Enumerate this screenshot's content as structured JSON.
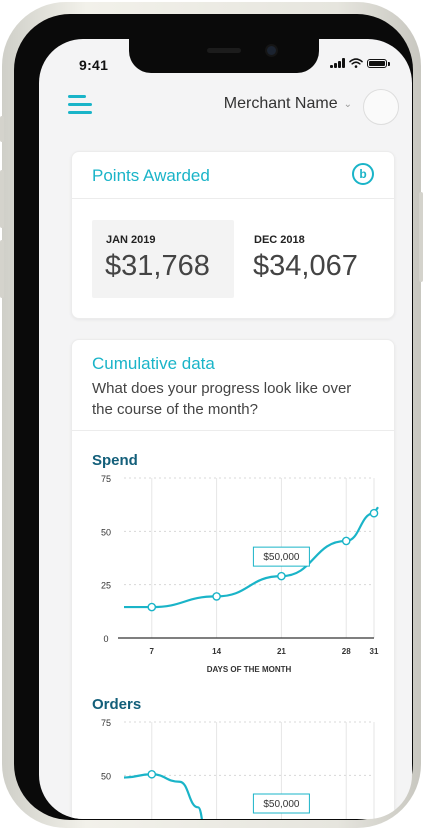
{
  "status_bar": {
    "time": "9:41"
  },
  "header": {
    "merchant_name": "Merchant Name",
    "merchant_chevron": "⌄"
  },
  "points_card": {
    "title": "Points Awarded",
    "badge_letter": "b",
    "periods": [
      {
        "label": "JAN 2019",
        "value": "$31,768"
      },
      {
        "label": "DEC 2018",
        "value": "$34,067"
      }
    ]
  },
  "cumulative_card": {
    "title": "Cumulative data",
    "subtitle": "What does your progress look like over the course of the month?"
  },
  "colors": {
    "accent": "#1ab4c8",
    "heading": "#135f7a"
  },
  "chart_data": [
    {
      "type": "line",
      "title": "Spend",
      "xlabel": "DAYS OF THE MONTH",
      "ylabel": "",
      "x_ticks": [
        "7",
        "14",
        "21",
        "28",
        "31"
      ],
      "y_ticks": [
        "75",
        "50",
        "25",
        "0"
      ],
      "ylim": [
        0,
        75
      ],
      "xlim": [
        4,
        31
      ],
      "grid": true,
      "series": [
        {
          "x": [
            7,
            14,
            21,
            28,
            31
          ],
          "y": [
            14.5,
            19.5,
            29,
            45.5,
            58.5
          ]
        }
      ],
      "annotation": {
        "x": 21,
        "y": 29,
        "label": "$50,000"
      }
    },
    {
      "type": "line",
      "title": "Orders",
      "xlabel": "",
      "ylabel": "",
      "y_ticks": [
        "75",
        "50"
      ],
      "ylim": [
        0,
        75
      ],
      "xlim": [
        4,
        31
      ],
      "grid": true,
      "series": [
        {
          "x": [
            4,
            7,
            10,
            12,
            13
          ],
          "y": [
            49,
            50.5,
            47,
            35,
            18
          ]
        }
      ],
      "annotation": {
        "label": "$50,000"
      }
    }
  ]
}
